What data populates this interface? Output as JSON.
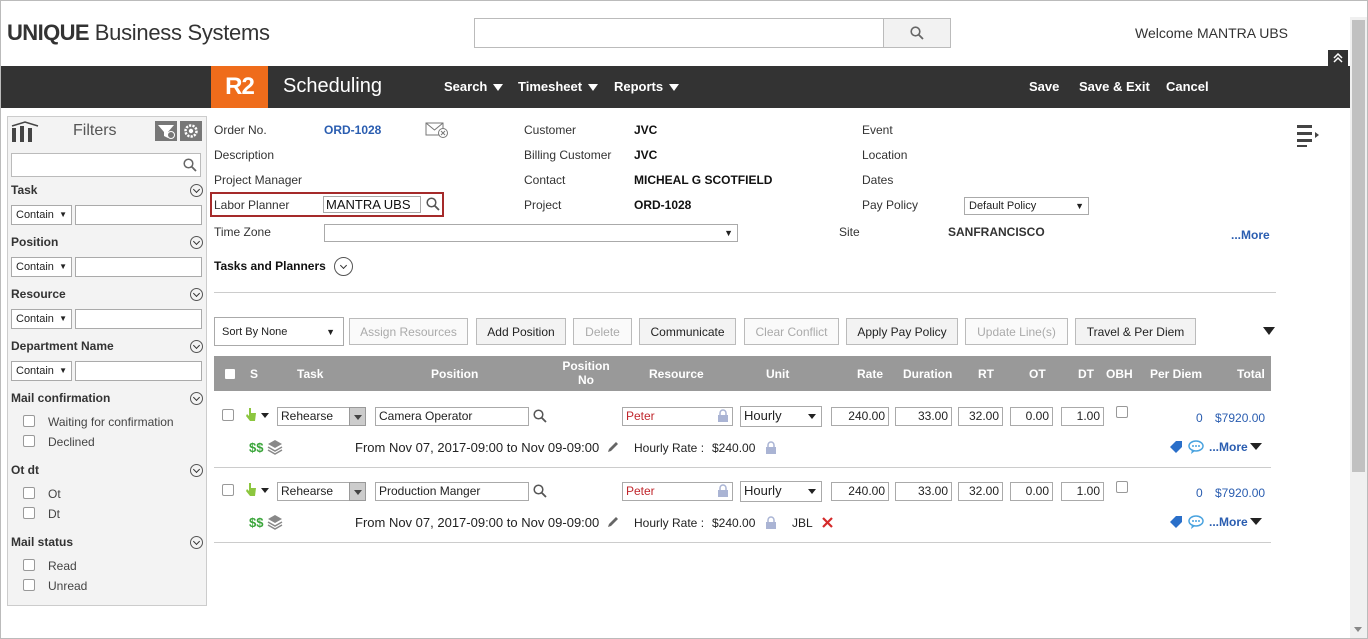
{
  "header": {
    "brand_bold": "UNIQUE",
    "brand_rest": " Business Systems",
    "welcome": "Welcome MANTRA UBS",
    "search_value": ""
  },
  "nav": {
    "logo": "R2",
    "title": "Scheduling",
    "menus": [
      "Search",
      "Timesheet",
      "Reports"
    ],
    "actions": [
      "Save",
      "Save & Exit",
      "Cancel"
    ]
  },
  "filters": {
    "title": "Filters",
    "contain_label": "Contain",
    "sections": [
      "Task",
      "Position",
      "Resource",
      "Department Name"
    ],
    "mail_confirmation": {
      "title": "Mail confirmation",
      "options": [
        "Waiting for confirmation",
        "Declined"
      ]
    },
    "ot_dt": {
      "title": "Ot dt",
      "options": [
        "Ot",
        "Dt"
      ]
    },
    "mail_status": {
      "title": "Mail status",
      "options": [
        "Read",
        "Unread"
      ]
    }
  },
  "form": {
    "order_no_label": "Order No.",
    "order_no": "ORD-1028",
    "description_label": "Description",
    "project_manager_label": "Project Manager",
    "labor_planner_label": "Labor Planner",
    "labor_planner": "MANTRA UBS",
    "time_zone_label": "Time Zone",
    "customer_label": "Customer",
    "customer": "JVC",
    "billing_customer_label": "Billing Customer",
    "billing_customer": "JVC",
    "contact_label": "Contact",
    "contact": "MICHEAL G SCOTFIELD",
    "project_label": "Project",
    "project": "ORD-1028",
    "event_label": "Event",
    "location_label": "Location",
    "dates_label": "Dates",
    "pay_policy_label": "Pay Policy",
    "pay_policy": "Default Policy",
    "site_label": "Site",
    "site": "SANFRANCISCO",
    "more": "...More",
    "tasks_planners": "Tasks and Planners"
  },
  "toolbar": {
    "sort": "Sort By None",
    "buttons": [
      "Assign Resources",
      "Add Position",
      "Delete",
      "Communicate",
      "Clear Conflict",
      "Apply Pay Policy",
      "Update Line(s)",
      "Travel & Per Diem"
    ]
  },
  "grid": {
    "columns": [
      "S",
      "Task",
      "Position",
      "Position No",
      "Resource",
      "Unit",
      "Rate",
      "Duration",
      "RT",
      "OT",
      "DT",
      "OBH",
      "Per Diem",
      "Total"
    ],
    "rows": [
      {
        "task": "Rehearse",
        "position": "Camera Operator",
        "resource": "Peter",
        "unit": "Hourly",
        "rate": "240.00",
        "duration": "33.00",
        "rt": "32.00",
        "ot": "0.00",
        "dt": "1.00",
        "per_diem": "0",
        "total": "$7920.00",
        "dates": "From Nov 07, 2017-09:00 to Nov 09-09:00",
        "hourly_rate_label": "Hourly Rate :",
        "hourly_rate": "$240.00",
        "extra": "",
        "more": "...More"
      },
      {
        "task": "Rehearse",
        "position": "Production Manger",
        "resource": "Peter",
        "unit": "Hourly",
        "rate": "240.00",
        "duration": "33.00",
        "rt": "32.00",
        "ot": "0.00",
        "dt": "1.00",
        "per_diem": "0",
        "total": "$7920.00",
        "dates": "From Nov 07, 2017-09:00 to Nov 09-09:00",
        "hourly_rate_label": "Hourly Rate :",
        "hourly_rate": "$240.00",
        "extra": "JBL",
        "more": "...More"
      }
    ]
  },
  "colors": {
    "accent": "#ef6c1b",
    "nav_bg": "#333333",
    "link": "#2a5db0",
    "grid_header": "#999999",
    "highlight_border": "#a52a2a"
  },
  "icons": [
    "search-icon",
    "filter-clear-icon",
    "gear-icon",
    "columns-icon",
    "mail-icon",
    "lock-icon",
    "pencil-icon",
    "money-icon",
    "layers-icon",
    "hand-icon",
    "tag-icon",
    "chat-icon",
    "close-icon",
    "menu-icon",
    "chevron-down-icon",
    "collapse-up-icon"
  ]
}
